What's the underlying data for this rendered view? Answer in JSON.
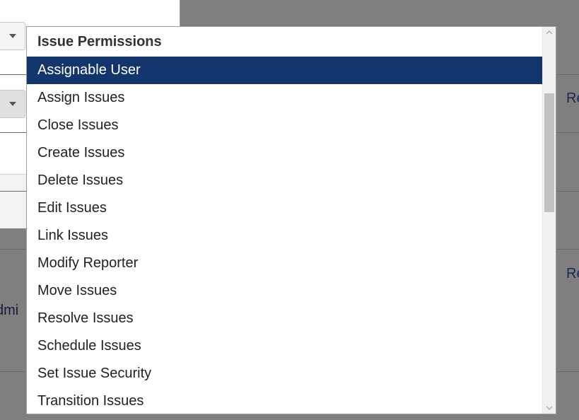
{
  "background": {
    "left_fragment_text": "dmi",
    "right_link_fragments": [
      "Re",
      "Re"
    ]
  },
  "dropdown": {
    "group_label": "Issue Permissions",
    "selected_index": 0,
    "options": [
      "Assignable User",
      "Assign Issues",
      "Close Issues",
      "Create Issues",
      "Delete Issues",
      "Edit Issues",
      "Link Issues",
      "Modify Reporter",
      "Move Issues",
      "Resolve Issues",
      "Schedule Issues",
      "Set Issue Security",
      "Transition Issues"
    ]
  },
  "colors": {
    "selected_bg": "#12356b",
    "overlay": "#7f7f7f"
  },
  "icons": {
    "scroll_up": "chevron-up-icon",
    "scroll_down": "chevron-down-icon",
    "select_caret": "caret-down-icon"
  }
}
